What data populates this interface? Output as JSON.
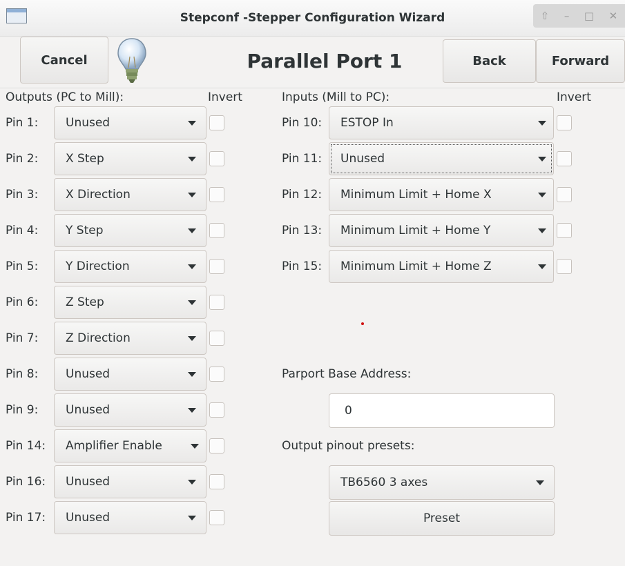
{
  "window": {
    "title": "Stepconf -Stepper Configuration Wizard",
    "controls": [
      "⇧",
      "–",
      "□",
      "✕"
    ]
  },
  "header": {
    "cancel_label": "Cancel",
    "page_title": "Parallel Port 1",
    "back_label": "Back",
    "forward_label": "Forward"
  },
  "outputs": {
    "heading": "Outputs (PC to Mill):",
    "invert_heading": "Invert",
    "rows": [
      {
        "pin": "Pin 1:",
        "value": "Unused"
      },
      {
        "pin": "Pin 2:",
        "value": "X Step"
      },
      {
        "pin": "Pin 3:",
        "value": "X Direction"
      },
      {
        "pin": "Pin 4:",
        "value": "Y Step"
      },
      {
        "pin": "Pin 5:",
        "value": "Y Direction"
      },
      {
        "pin": "Pin 6:",
        "value": "Z Step"
      },
      {
        "pin": "Pin 7:",
        "value": "Z Direction"
      },
      {
        "pin": "Pin 8:",
        "value": "Unused"
      },
      {
        "pin": "Pin 9:",
        "value": "Unused"
      },
      {
        "pin": "Pin 14:",
        "value": "Amplifier Enable"
      },
      {
        "pin": "Pin 16:",
        "value": "Unused"
      },
      {
        "pin": "Pin 17:",
        "value": "Unused"
      }
    ]
  },
  "inputs": {
    "heading": "Inputs (Mill to PC):",
    "invert_heading": "Invert",
    "rows": [
      {
        "pin": "Pin 10:",
        "value": "ESTOP In"
      },
      {
        "pin": "Pin 11:",
        "value": "Unused"
      },
      {
        "pin": "Pin 12:",
        "value": "Minimum Limit + Home X"
      },
      {
        "pin": "Pin 13:",
        "value": "Minimum Limit + Home Y"
      },
      {
        "pin": "Pin 15:",
        "value": "Minimum Limit + Home Z"
      }
    ]
  },
  "parport": {
    "label": "Parport Base Address:",
    "value": "0"
  },
  "presets": {
    "label": "Output pinout presets:",
    "selected": "TB6560 3 axes",
    "button_label": "Preset"
  }
}
